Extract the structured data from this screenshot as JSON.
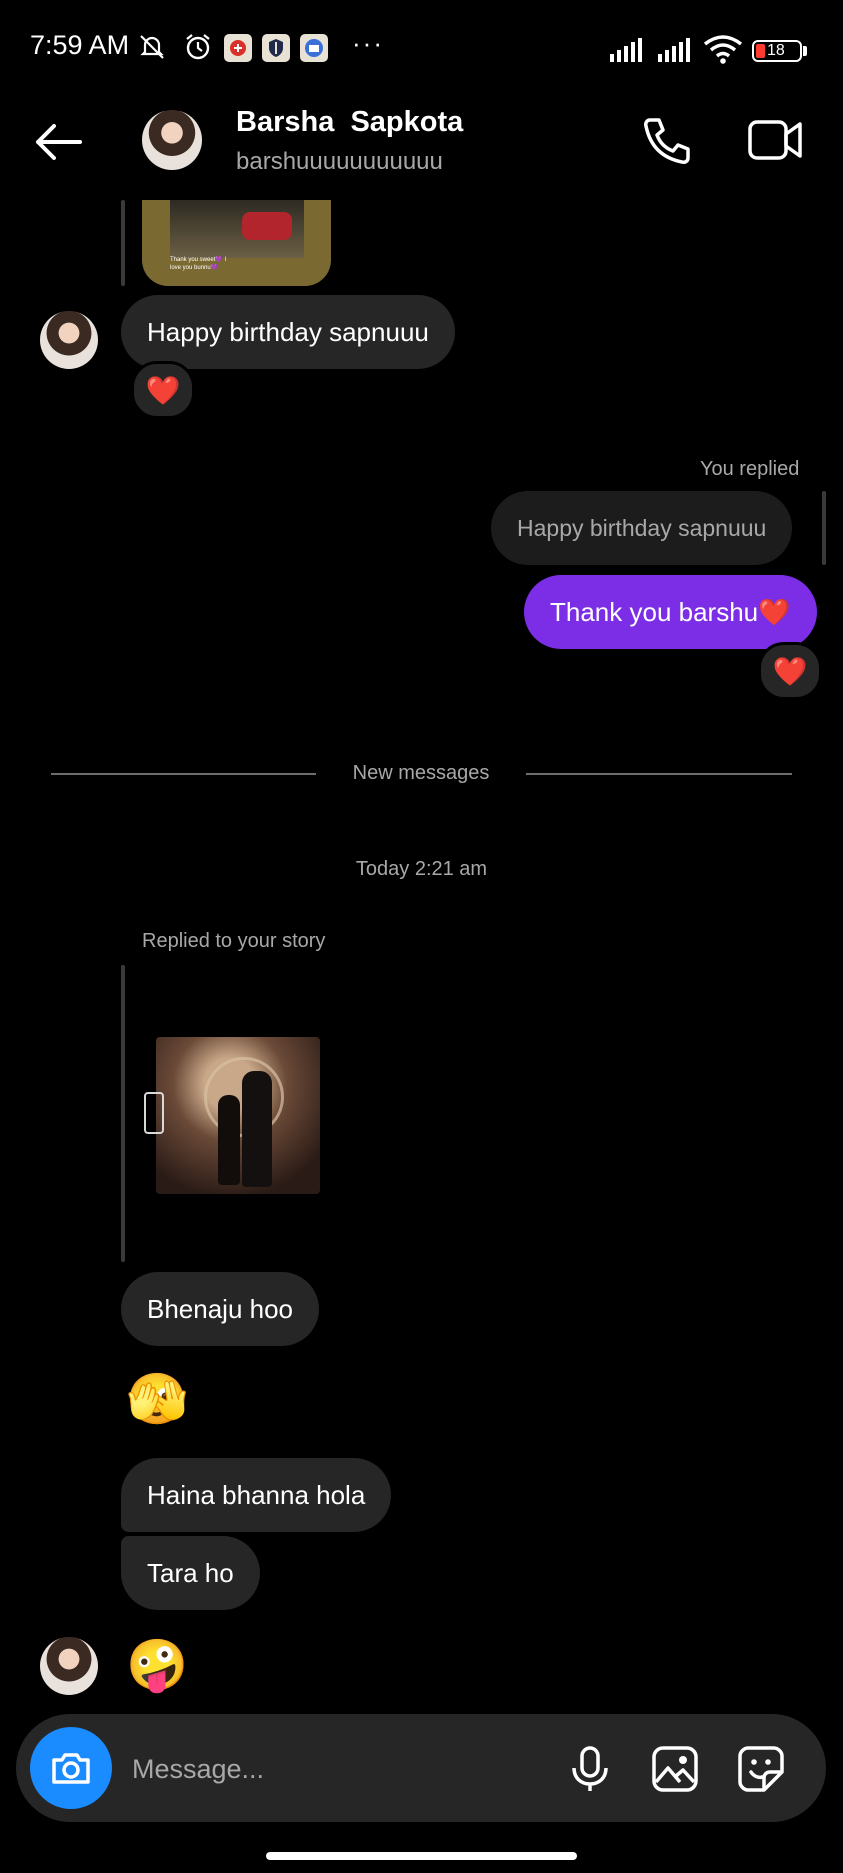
{
  "status_bar": {
    "time": "7:59 AM",
    "battery": "18",
    "more": "···"
  },
  "header": {
    "name": "Barsha  Sapkota",
    "username": "barshuuuuuuuuuuu",
    "icons": [
      "back-arrow-icon",
      "phone-icon",
      "video-camera-icon"
    ]
  },
  "messages": {
    "story_thumb_caption": "Thank you sweet💜 I love you bunnu💜",
    "m1_text": "Happy birthday sapnuuu",
    "m1_reaction": "❤️",
    "you_replied_label": "You replied",
    "quoted_text": "Happy birthday sapnuuu",
    "m2_text": "Thank you barshu❤️",
    "m2_reaction": "❤️",
    "new_messages_label": "New messages",
    "timestamp": "Today 2:21 am",
    "story_reply_label": "Replied to your story",
    "m3_text": "Bhenaju hoo",
    "m4_emoji": "🫣",
    "m5_text": "Haina bhanna hola",
    "m6_text": "Tara ho",
    "m7_emoji": "🤪"
  },
  "composer": {
    "placeholder": "Message...",
    "icons": [
      "camera-icon",
      "microphone-icon",
      "gallery-icon",
      "sticker-icon"
    ]
  },
  "colors": {
    "background": "#000000",
    "incoming_bubble": "#262626",
    "outgoing_bubble": "#7b2ee6",
    "camera_button": "#1a8cff"
  }
}
